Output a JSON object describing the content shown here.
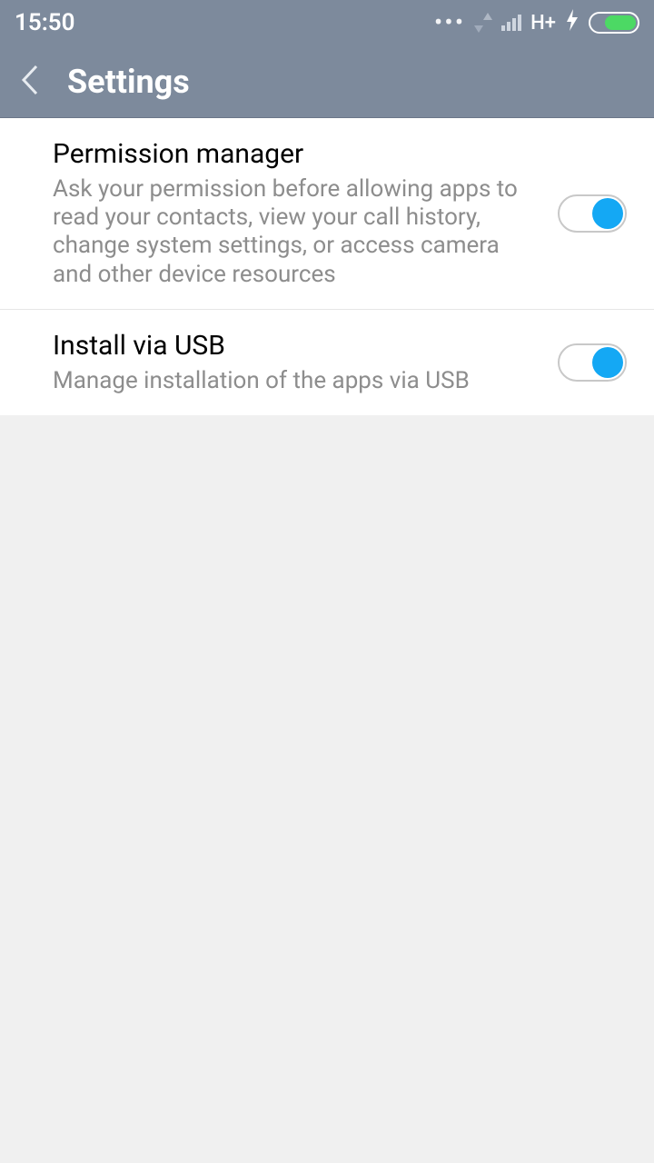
{
  "status": {
    "time": "15:50",
    "dots": "•••",
    "network_label": "H+",
    "lightning": "⚡"
  },
  "header": {
    "title": "Settings"
  },
  "settings": [
    {
      "title": "Permission manager",
      "description": "Ask your permission before allowing apps to read your contacts, view your call history, change system settings, or access camera and other device resources",
      "enabled": true
    },
    {
      "title": "Install via USB",
      "description": "Manage installation of the apps via USB",
      "enabled": true
    }
  ]
}
